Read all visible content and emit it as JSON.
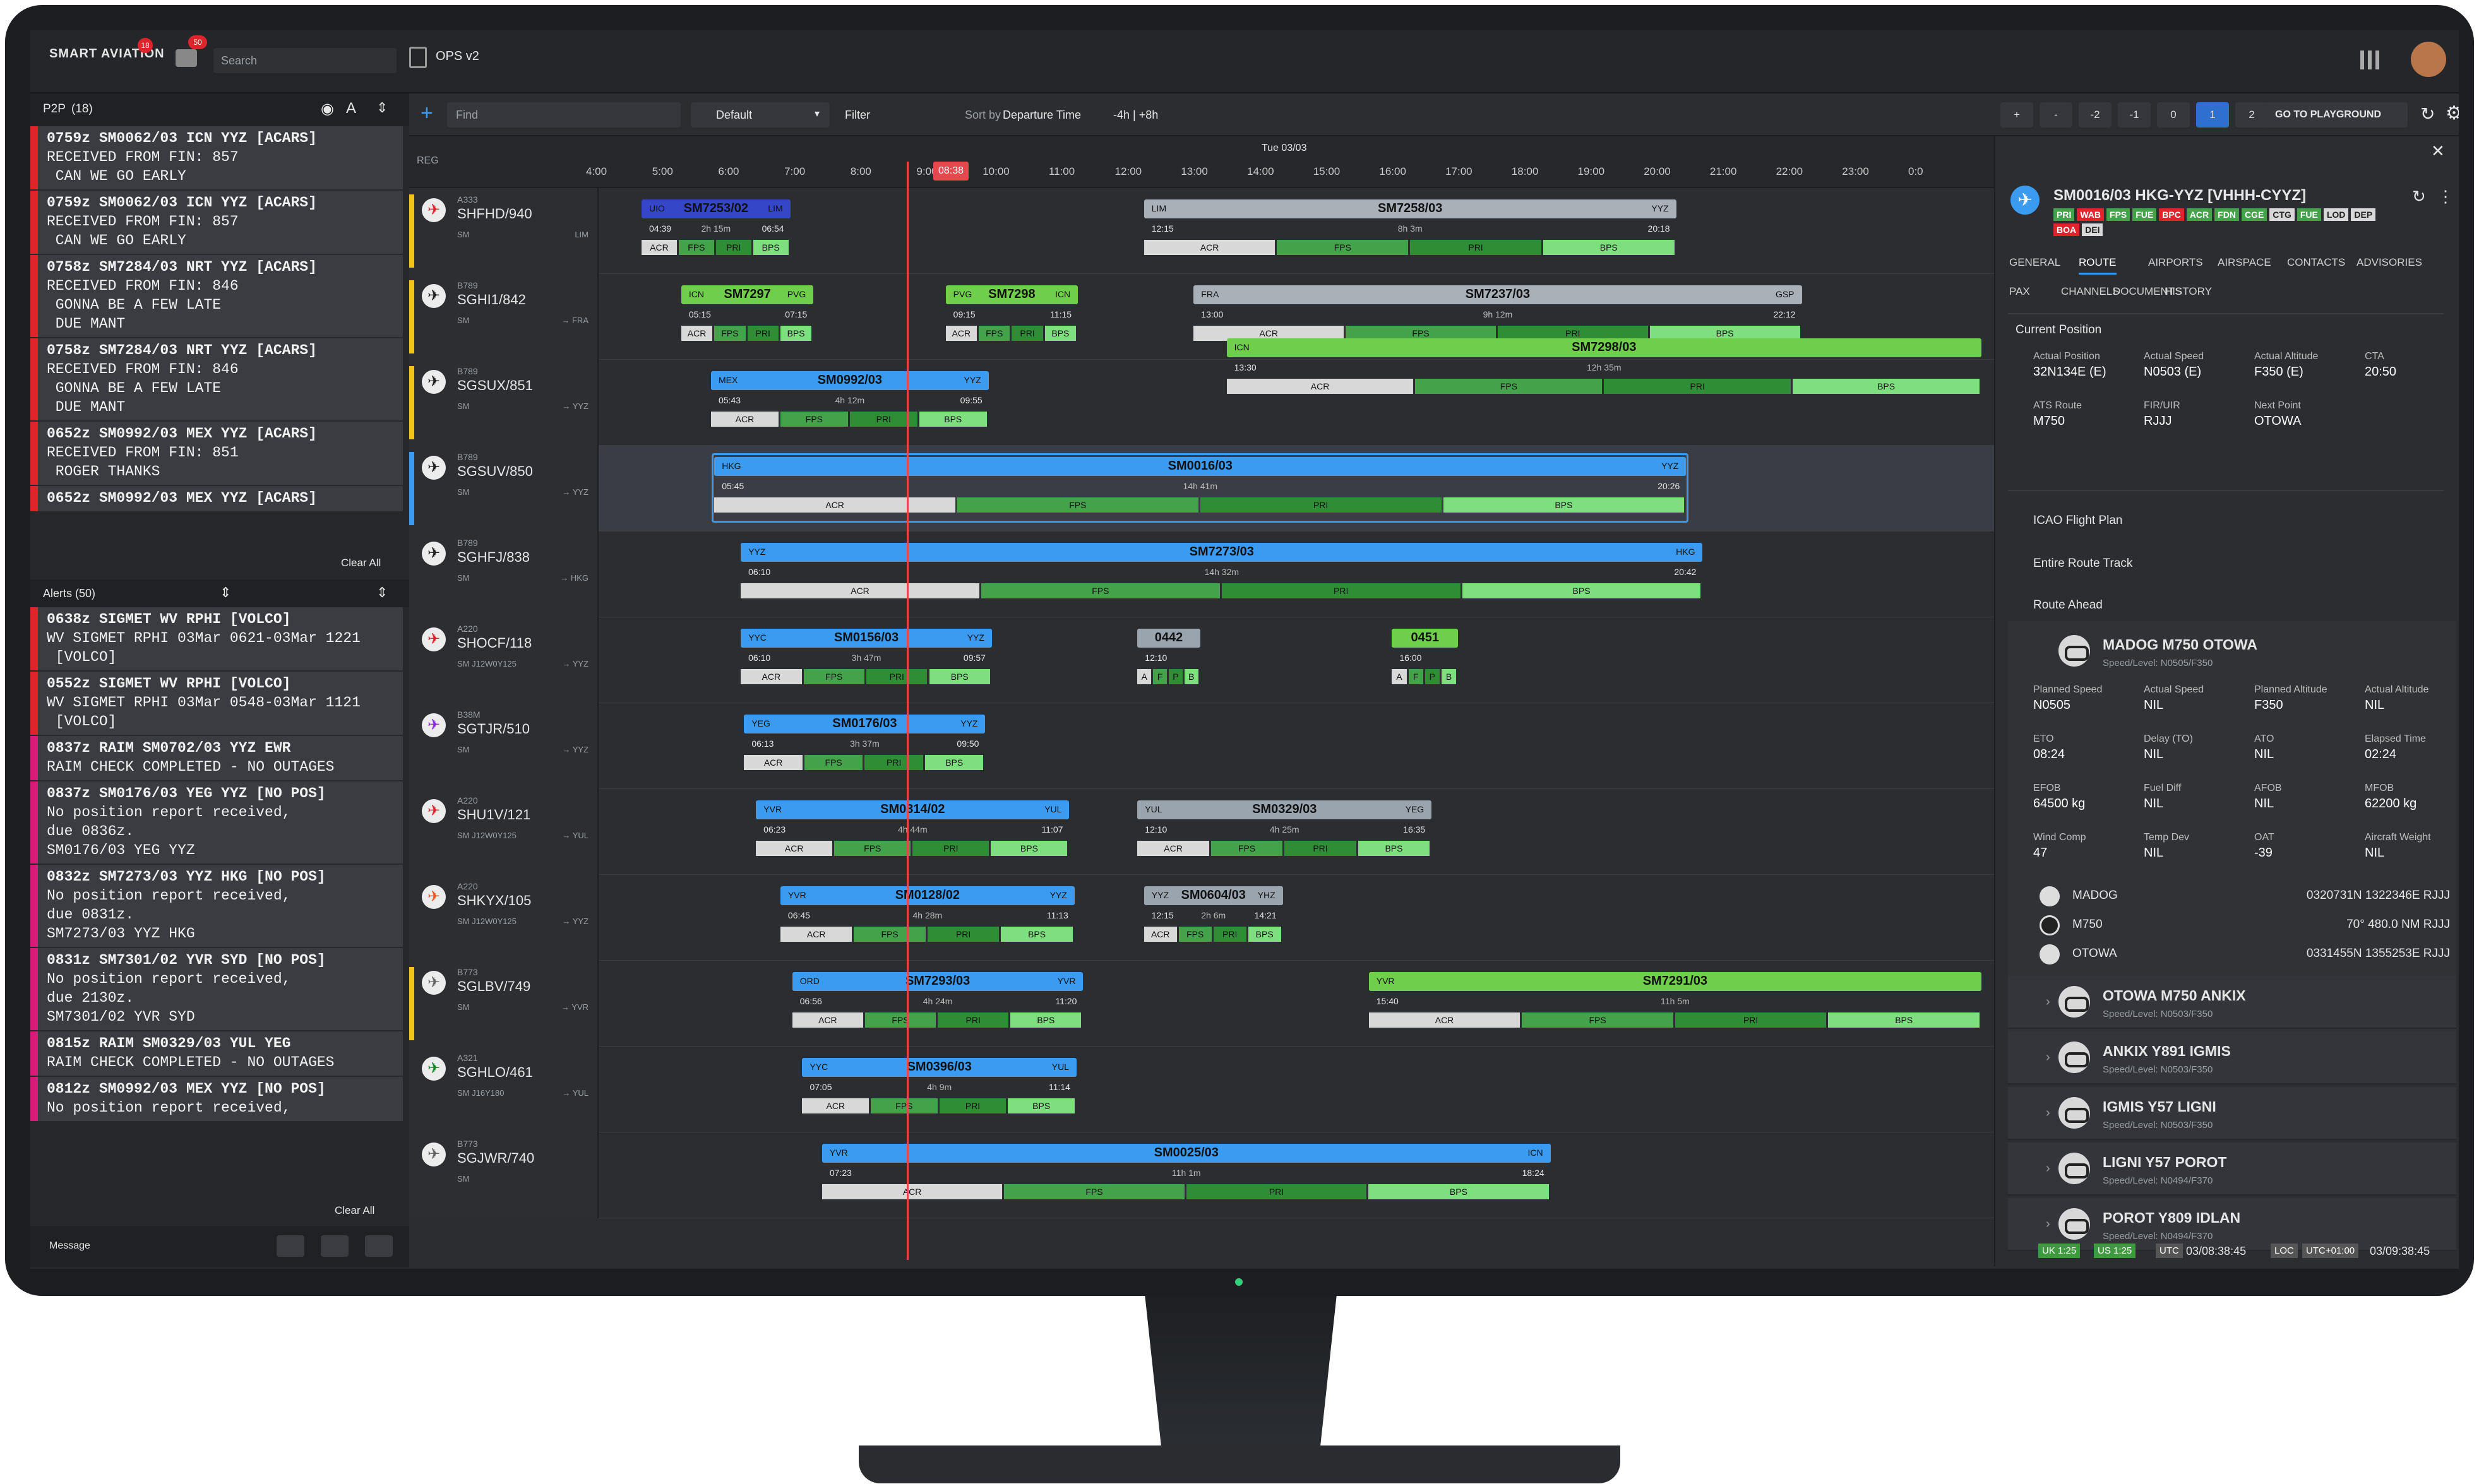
{
  "app": {
    "logo": "SMART AVIATION",
    "notif_count_1": "18",
    "notif_count_2": "50",
    "search_placeholder": "Search",
    "workspace": "OPS v2"
  },
  "toolbar": {
    "find_placeholder": "Find",
    "preset": "Default",
    "filter": "Filter",
    "sort_prefix": "Sort by",
    "sort_value": "Departure Time",
    "window": "-4h | +8h",
    "zoom_buttons": [
      "+",
      "-",
      "-2",
      "-1",
      "0",
      "1",
      "2"
    ],
    "playground": "GO TO PLAYGROUND"
  },
  "p2p": {
    "title": "P2P",
    "count": "(18)",
    "messages": [
      {
        "lines": [
          "0759z SM0062/03 ICN YYZ [ACARS]",
          "RECEIVED FROM FIN: 857",
          " CAN WE GO EARLY"
        ],
        "color": "#e0242c"
      },
      {
        "lines": [
          "0759z SM0062/03 ICN YYZ [ACARS]",
          "RECEIVED FROM FIN: 857",
          " CAN WE GO EARLY"
        ],
        "color": "#e0242c"
      },
      {
        "lines": [
          "0758z SM7284/03 NRT YYZ [ACARS]",
          "RECEIVED FROM FIN: 846",
          " GONNA BE A FEW LATE",
          " DUE MANT"
        ],
        "color": "#e0242c"
      },
      {
        "lines": [
          "0758z SM7284/03 NRT YYZ [ACARS]",
          "RECEIVED FROM FIN: 846",
          " GONNA BE A FEW LATE",
          " DUE MANT"
        ],
        "color": "#e0242c"
      },
      {
        "lines": [
          "0652z SM0992/03 MEX YYZ [ACARS]",
          "RECEIVED FROM FIN: 851",
          " ROGER THANKS"
        ],
        "color": "#e0242c"
      },
      {
        "lines": [
          "0652z SM0992/03 MEX YYZ [ACARS]"
        ],
        "color": "#e0242c"
      }
    ],
    "clear_all": "Clear All"
  },
  "alerts": {
    "title": "Alerts (50)",
    "items": [
      {
        "lines": [
          "0638z SIGMET WV RPHI [VOLCO]",
          "WV SIGMET RPHI 03Mar 0621-03Mar 1221",
          " [VOLCO]"
        ],
        "color": "#e0242c"
      },
      {
        "lines": [
          "0552z SIGMET WV RPHI [VOLCO]",
          "WV SIGMET RPHI 03Mar 0548-03Mar 1121",
          " [VOLCO]"
        ],
        "color": "#e0242c"
      },
      {
        "lines": [
          "0837z RAIM SM0702/03 YYZ EWR",
          "RAIM CHECK COMPLETED - NO OUTAGES"
        ],
        "color": "#d81b78"
      },
      {
        "lines": [
          "0837z SM0176/03 YEG YYZ [NO POS]",
          "No position report received,",
          "due 0836z.",
          "SM0176/03 YEG YYZ"
        ],
        "color": "#d81b78"
      },
      {
        "lines": [
          "0832z SM7273/03 YYZ HKG [NO POS]",
          "No position report received,",
          "due 0831z.",
          "SM7273/03 YYZ HKG"
        ],
        "color": "#d81b78"
      },
      {
        "lines": [
          "0831z SM7301/02 YVR SYD [NO POS]",
          "No position report received,",
          "due 2130z.",
          "SM7301/02 YVR SYD"
        ],
        "color": "#d81b78"
      },
      {
        "lines": [
          "0815z RAIM SM0329/03 YUL YEG",
          "RAIM CHECK COMPLETED - NO OUTAGES"
        ],
        "color": "#d81b78"
      },
      {
        "lines": [
          "0812z SM0992/03 MEX YYZ [NO POS]",
          "No position report received,"
        ],
        "color": "#d81b78"
      }
    ],
    "clear_all": "Clear All"
  },
  "bottom_left": {
    "message": "Message"
  },
  "timeline": {
    "reg_header": "REG",
    "date": "Tue 03/03",
    "hours": [
      "4:00",
      "5:00",
      "6:00",
      "7:00",
      "8:00",
      "9:00",
      "10:00",
      "11:00",
      "12:00",
      "13:00",
      "14:00",
      "15:00",
      "16:00",
      "17:00",
      "18:00",
      "19:00",
      "20:00",
      "21:00",
      "22:00",
      "23:00",
      "0:0"
    ],
    "now": "08:38",
    "segments": [
      "ACR",
      "FPS",
      "PRI",
      "BPS"
    ],
    "rows": [
      {
        "type": "A333",
        "reg": "SHFHD/940",
        "owner": "SM",
        "dest": "LIM",
        "color": "#e0242c"
      },
      {
        "type": "B789",
        "reg": "SGHI1/842",
        "owner": "SM",
        "dest": "→ FRA",
        "color": "#222"
      },
      {
        "type": "B789",
        "reg": "SGSUX/851",
        "owner": "SM",
        "dest": "→ YYZ",
        "color": "#222"
      },
      {
        "type": "B789",
        "reg": "SGSUV/850",
        "owner": "SM",
        "dest": "→ YYZ",
        "color": "#222"
      },
      {
        "type": "B789",
        "reg": "SGHFJ/838",
        "owner": "SM",
        "dest": "→ HKG",
        "color": "#222"
      },
      {
        "type": "A220",
        "reg": "SHOCF/118",
        "owner": "SM  J12W0Y125",
        "dest": "→ YYZ",
        "color": "#e0242c"
      },
      {
        "type": "B38M",
        "reg": "SGTJR/510",
        "owner": "SM",
        "dest": "→ YYZ",
        "color": "#8a2be2"
      },
      {
        "type": "A220",
        "reg": "SHU1V/121",
        "owner": "SM  J12W0Y125",
        "dest": "→ YUL",
        "color": "#e0242c"
      },
      {
        "type": "A220",
        "reg": "SHKYX/105",
        "owner": "SM  J12W0Y125",
        "dest": "→ YYZ",
        "color": "#f05a22"
      },
      {
        "type": "B773",
        "reg": "SGLBV/749",
        "owner": "SM",
        "dest": "→ YVR",
        "color": "#666"
      },
      {
        "type": "A321",
        "reg": "SGHLO/461",
        "owner": "SM  J16Y180",
        "dest": "→ YUL",
        "color": "#1a8a2a"
      },
      {
        "type": "B773",
        "reg": "SGJWR/740",
        "owner": "SM",
        "dest": "",
        "color": "#666"
      }
    ],
    "flights": [
      {
        "id": "SM7253/02",
        "o": "UIO",
        "d": "LIM",
        "dep": "04:39",
        "dur": "2h 15m",
        "arr": "06:54"
      },
      {
        "id": "SM7258/03",
        "o": "LIM",
        "d": "YYZ",
        "dep": "12:15",
        "dur": "8h 3m",
        "arr": "20:18"
      },
      {
        "id": "SM7297",
        "o": "ICN",
        "d": "PVG",
        "dep": "05:15",
        "dur": "",
        "arr": "07:15"
      },
      {
        "id": "SM7298",
        "o": "PVG",
        "d": "ICN",
        "dep": "09:15",
        "dur": "",
        "arr": "11:15"
      },
      {
        "id": "SM7237/03",
        "o": "FRA",
        "d": "GSP",
        "dep": "13:00",
        "dur": "9h 12m",
        "arr": "22:12"
      },
      {
        "id": "SM7298/03",
        "o": "ICN",
        "d": "",
        "dep": "13:30",
        "dur": "12h 35m",
        "arr": ""
      },
      {
        "id": "SM0992/03",
        "o": "MEX",
        "d": "YYZ",
        "dep": "05:43",
        "dur": "4h 12m",
        "arr": "09:55"
      },
      {
        "id": "SM0016/03",
        "o": "HKG",
        "d": "YYZ",
        "dep": "05:45",
        "dur": "14h 41m",
        "arr": "20:26"
      },
      {
        "id": "SM7273/03",
        "o": "YYZ",
        "d": "HKG",
        "dep": "06:10",
        "dur": "14h 32m",
        "arr": "20:42"
      },
      {
        "id": "SM0156/03",
        "o": "YYC",
        "d": "YYZ",
        "dep": "06:10",
        "dur": "3h 47m",
        "arr": "09:57"
      },
      {
        "id": "0442",
        "o": "",
        "d": "",
        "dep": "12:10",
        "dur": "",
        "arr": ""
      },
      {
        "id": "0451",
        "o": "",
        "d": "",
        "dep": "16:00",
        "dur": "",
        "arr": ""
      },
      {
        "id": "SM0176/03",
        "o": "YEG",
        "d": "YYZ",
        "dep": "06:13",
        "dur": "3h 37m",
        "arr": "09:50"
      },
      {
        "id": "SM0314/02",
        "o": "YVR",
        "d": "YUL",
        "dep": "06:23",
        "dur": "4h 44m",
        "arr": "11:07"
      },
      {
        "id": "SM0329/03",
        "o": "YUL",
        "d": "YEG",
        "dep": "12:10",
        "dur": "4h 25m",
        "arr": "16:35"
      },
      {
        "id": "SM0128/02",
        "o": "YVR",
        "d": "YYZ",
        "dep": "06:45",
        "dur": "4h 28m",
        "arr": "11:13"
      },
      {
        "id": "SM0604/03",
        "o": "YYZ",
        "d": "YHZ",
        "dep": "12:15",
        "dur": "2h 6m",
        "arr": "14:21"
      },
      {
        "id": "SM7293/03",
        "o": "ORD",
        "d": "YVR",
        "dep": "06:56",
        "dur": "4h 24m",
        "arr": "11:20"
      },
      {
        "id": "SM7291/03",
        "o": "YVR",
        "d": "",
        "dep": "15:40",
        "dur": "11h 5m",
        "arr": ""
      },
      {
        "id": "SM0396/03",
        "o": "YYC",
        "d": "YUL",
        "dep": "07:05",
        "dur": "4h 9m",
        "arr": "11:14"
      },
      {
        "id": "SM0025/03",
        "o": "YVR",
        "d": "ICN",
        "dep": "07:23",
        "dur": "11h 1m",
        "arr": "18:24"
      }
    ]
  },
  "detail": {
    "title": "SM0016/03 HKG-YYZ [VHHH-CYYZ]",
    "badges": [
      "PRI",
      "WAB",
      "FPS",
      "FUE",
      "BPC",
      "ACR",
      "FDN",
      "CGE",
      "CTG",
      "FUE",
      "LOD",
      "DEP",
      "BOA",
      "DEI"
    ],
    "tabs1": [
      "GENERAL",
      "ROUTE",
      "AIRPORTS",
      "AIRSPACE",
      "CONTACTS",
      "ADVISORIES"
    ],
    "tabs2": [
      "PAX",
      "CHANNELS",
      "DOCUMENTS",
      "HISTORY"
    ],
    "current_position": "Current Position",
    "cp": [
      {
        "label": "Actual Position",
        "value": "32N134E (E)"
      },
      {
        "label": "Actual Speed",
        "value": "N0503 (E)"
      },
      {
        "label": "Actual Altitude",
        "value": "F350 (E)"
      },
      {
        "label": "CTA",
        "value": "20:50"
      },
      {
        "label": "ATS Route",
        "value": "M750"
      },
      {
        "label": "FIR/UIR",
        "value": "RJJJ"
      },
      {
        "label": "Next Point",
        "value": "OTOWA"
      }
    ],
    "icao_fp": "ICAO Flight Plan",
    "entire_route": "Entire Route Track",
    "route_ahead": "Route Ahead",
    "leg1": {
      "title": "MADOG M750 OTOWA",
      "sub": "Speed/Level: N0505/F350"
    },
    "leg1_fields": [
      {
        "label": "Planned Speed",
        "value": "N0505"
      },
      {
        "label": "Actual Speed",
        "value": "NIL"
      },
      {
        "label": "Planned Altitude",
        "value": "F350"
      },
      {
        "label": "Actual Altitude",
        "value": "NIL"
      },
      {
        "label": "ETO",
        "value": "08:24"
      },
      {
        "label": "Delay (TO)",
        "value": "NIL"
      },
      {
        "label": "ATO",
        "value": "NIL"
      },
      {
        "label": "Elapsed Time",
        "value": "02:24"
      },
      {
        "label": "EFOB",
        "value": "64500 kg"
      },
      {
        "label": "Fuel Diff",
        "value": "NIL"
      },
      {
        "label": "AFOB",
        "value": "NIL"
      },
      {
        "label": "MFOB",
        "value": "62200 kg"
      },
      {
        "label": "Wind Comp",
        "value": "47"
      },
      {
        "label": "Temp Dev",
        "value": "NIL"
      },
      {
        "label": "OAT",
        "value": "-39"
      },
      {
        "label": "Aircraft Weight",
        "value": "NIL"
      }
    ],
    "points": [
      {
        "name": "MADOG",
        "info": "0320731N 1322346E RJJJ"
      },
      {
        "name": "M750",
        "info": "70° 480.0 NM RJJJ"
      },
      {
        "name": "OTOWA",
        "info": "0331455N 1355253E RJJJ"
      }
    ],
    "legs": [
      {
        "title": "OTOWA M750 ANKIX",
        "sub": "Speed/Level: N0503/F350"
      },
      {
        "title": "ANKIX Y891 IGMIS",
        "sub": "Speed/Level: N0503/F350"
      },
      {
        "title": "IGMIS Y57 LIGNI",
        "sub": "Speed/Level: N0503/F350"
      },
      {
        "title": "LIGNI Y57 POROT",
        "sub": "Speed/Level: N0494/F370"
      },
      {
        "title": "POROT Y809 IDLAN",
        "sub": "Speed/Level: N0494/F370"
      }
    ]
  },
  "status": {
    "uk": "UK 1:25",
    "us": "US 1:25",
    "utc_label": "UTC",
    "utc": "03/08:38:45",
    "loc_label": "LOC",
    "loc_offset": "UTC+01:00",
    "loc": "03/09:38:45"
  }
}
